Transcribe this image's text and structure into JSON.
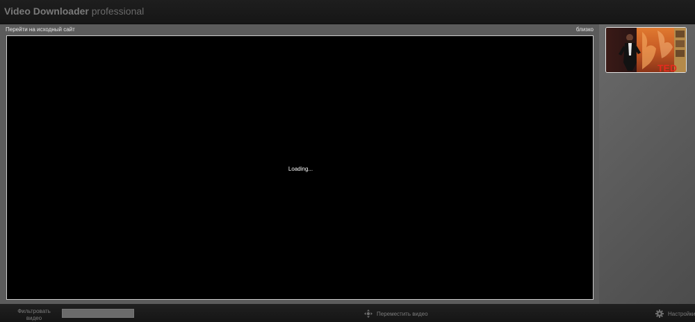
{
  "header": {
    "brand": "Video Downloader",
    "edition": "professional"
  },
  "player": {
    "goto_link": "Перейти на исходный сайт",
    "close_link": "близко",
    "loading_text": "Loading..."
  },
  "sidebar": {
    "thumbnail_badge": "TED"
  },
  "footer": {
    "filter_label": "Фильтровать видео",
    "filter_value": "",
    "move_label": "Переместить видео",
    "settings_label": "Настройки"
  },
  "icons": {
    "move": "move-arrows-icon",
    "settings": "gear-icon"
  },
  "colors": {
    "ted_red": "#e62b1e"
  }
}
